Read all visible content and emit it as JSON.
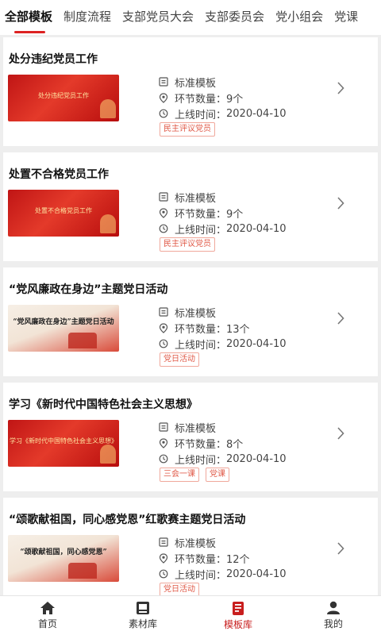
{
  "tabs": [
    "全部模板",
    "制度流程",
    "支部党员大会",
    "支部委员会",
    "党小组会",
    "党课"
  ],
  "active_tab_index": 0,
  "labels": {
    "template_type": "标准模板",
    "steps_prefix": "环节数量：",
    "online_prefix": "上线时间："
  },
  "cards": [
    {
      "title": "处分违纪党员工作",
      "thumb_text": "处分违纪党员工作",
      "thumb_style": "red",
      "template_type": "标准模板",
      "steps": "9个",
      "online_time": "2020-04-10",
      "tags": [
        "民主评议党员"
      ]
    },
    {
      "title": "处置不合格党员工作",
      "thumb_text": "处置不合格党员工作",
      "thumb_style": "red",
      "template_type": "标准模板",
      "steps": "9个",
      "online_time": "2020-04-10",
      "tags": [
        "民主评议党员"
      ]
    },
    {
      "title": "“党风廉政在身边”主题党日活动",
      "thumb_text": "“党风廉政在身边”主题党日活动",
      "thumb_style": "light",
      "template_type": "标准模板",
      "steps": "13个",
      "online_time": "2020-04-10",
      "tags": [
        "党日活动"
      ]
    },
    {
      "title": "学习《新时代中国特色社会主义思想》",
      "thumb_text": "学习《新时代中国特色社会主义思想》",
      "thumb_style": "red",
      "template_type": "标准模板",
      "steps": "8个",
      "online_time": "2020-04-10",
      "tags": [
        "三会一课",
        "党课"
      ]
    },
    {
      "title": "“颂歌献祖国，同心感党恩”红歌赛主题党日活动",
      "thumb_text": "“颂歌献祖国，同心感党恩”",
      "thumb_style": "light",
      "template_type": "标准模板",
      "steps": "12个",
      "online_time": "2020-04-10",
      "tags": [
        "党日活动"
      ]
    }
  ],
  "bottom_nav": [
    {
      "label": "首页",
      "icon": "home-icon"
    },
    {
      "label": "素材库",
      "icon": "material-icon"
    },
    {
      "label": "模板库",
      "icon": "template-icon"
    },
    {
      "label": "我的",
      "icon": "profile-icon"
    }
  ],
  "active_nav_index": 2,
  "colors": {
    "accent": "#c81e1e",
    "tag_text": "#e05a48",
    "tag_border": "#f0a89c",
    "background": "#eeeeee"
  }
}
